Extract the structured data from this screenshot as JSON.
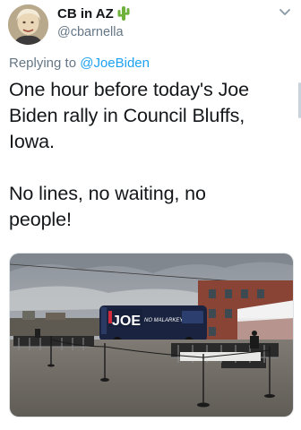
{
  "author": {
    "display_name": "CB in AZ",
    "handle": "@cbarnella",
    "avatar_icon": "avatar-photo",
    "badge_icon": "cactus-emoji-icon"
  },
  "reply": {
    "prefix": "Replying to",
    "to_handle": "@JoeBiden"
  },
  "tweet": {
    "line1": "One hour before today's Joe",
    "line2": "Biden rally in Council Bluffs,",
    "line3": "Iowa.",
    "line4": "No lines, no waiting, no",
    "line5": "people!"
  },
  "media": {
    "bus_logo_text": "JOE",
    "bus_slogan_text": "NO MALARKEY!"
  },
  "colors": {
    "link": "#1da1f2",
    "secondary_text": "#657786",
    "primary_text": "#14171a"
  }
}
